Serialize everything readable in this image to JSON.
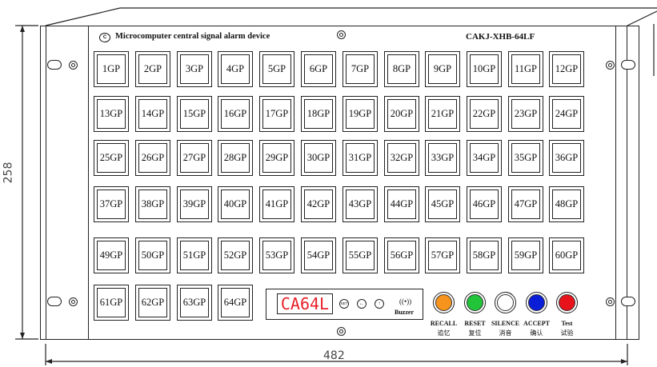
{
  "header": {
    "logo_text": "C",
    "brand": "Microcomputer central signal alarm device",
    "model": "CAKJ-XHB-64LF"
  },
  "tiles": [
    "1GP",
    "2GP",
    "3GP",
    "4GP",
    "5GP",
    "6GP",
    "7GP",
    "8GP",
    "9GP",
    "10GP",
    "11GP",
    "12GP",
    "13GP",
    "14GP",
    "15GP",
    "16GP",
    "17GP",
    "18GP",
    "19GP",
    "20GP",
    "21GP",
    "22GP",
    "23GP",
    "24GP",
    "25GP",
    "26GP",
    "27GP",
    "28GP",
    "29GP",
    "30GP",
    "31GP",
    "32GP",
    "33GP",
    "34GP",
    "35GP",
    "36GP",
    "37GP",
    "38GP",
    "39GP",
    "40GP",
    "41GP",
    "42GP",
    "43GP",
    "44GP",
    "45GP",
    "46GP",
    "47GP",
    "48GP",
    "49GP",
    "50GP",
    "51GP",
    "52GP",
    "53GP",
    "54GP",
    "55GP",
    "56GP",
    "57GP",
    "58GP",
    "59GP",
    "60GP",
    "61GP",
    "62GP",
    "63GP",
    "64GP"
  ],
  "display": {
    "led_text": "CA64L",
    "set_label": "SET",
    "buzzer_label": "Buzzer"
  },
  "buttons": [
    {
      "en": "RECALL",
      "cn": "追忆",
      "color": "#f7941d"
    },
    {
      "en": "RESET",
      "cn": "复位",
      "color": "#22c43a"
    },
    {
      "en": "SILENCE",
      "cn": "消音",
      "color": "#ffffff"
    },
    {
      "en": "ACCEPT",
      "cn": "确认",
      "color": "#0a1ed8"
    },
    {
      "en": "Test",
      "cn": "试验",
      "color": "#e8131a"
    }
  ],
  "dimensions": {
    "height": "258",
    "width": "482"
  }
}
